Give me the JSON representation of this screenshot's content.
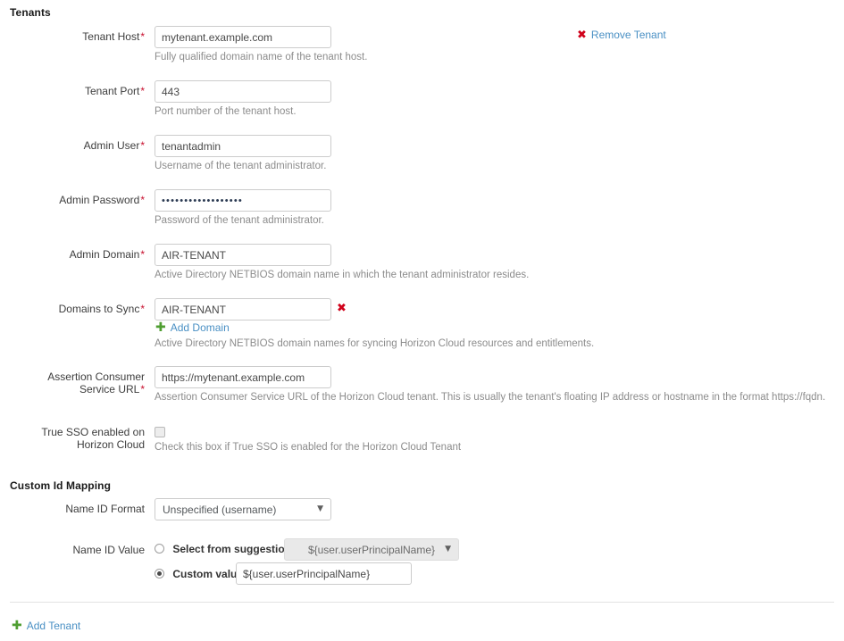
{
  "sections": {
    "tenants_title": "Tenants",
    "custom_id_mapping_title": "Custom Id Mapping"
  },
  "actions": {
    "remove_tenant": "Remove Tenant",
    "remove_tenant_icon": "x-icon",
    "add_domain": "Add Domain",
    "add_domain_icon": "plus-icon",
    "remove_domain_icon": "x-icon",
    "add_tenant": "Add Tenant",
    "add_tenant_icon": "plus-icon"
  },
  "fields": {
    "tenant_host": {
      "label": "Tenant Host",
      "required": "*",
      "value": "mytenant.example.com",
      "help": "Fully qualified domain name of the tenant host."
    },
    "tenant_port": {
      "label": "Tenant Port",
      "required": "*",
      "value": "443",
      "help": "Port number of the tenant host."
    },
    "admin_user": {
      "label": "Admin User",
      "required": "*",
      "value": "tenantadmin",
      "help": "Username of the tenant administrator."
    },
    "admin_password": {
      "label": "Admin Password",
      "required": "*",
      "value": "••••••••••••••••••",
      "help": "Password of the tenant administrator."
    },
    "admin_domain": {
      "label": "Admin Domain",
      "required": "*",
      "value": "AIR-TENANT",
      "help": "Active Directory NETBIOS domain name in which the tenant administrator resides."
    },
    "domains_to_sync": {
      "label": "Domains to Sync",
      "required": "*",
      "value": "AIR-TENANT",
      "help": "Active Directory NETBIOS domain names for syncing Horizon Cloud resources and entitlements."
    },
    "acs_url": {
      "label_line1": "Assertion Consumer",
      "label_line2": "Service URL",
      "required": "*",
      "value": "https://mytenant.example.com",
      "help": "Assertion Consumer Service URL of the Horizon Cloud tenant. This is usually the tenant's floating IP address or hostname in the format https://fqdn."
    },
    "true_sso": {
      "label_line1": "True SSO enabled on",
      "label_line2": "Horizon Cloud",
      "checked": false,
      "help": "Check this box if True SSO is enabled for the Horizon Cloud Tenant"
    },
    "name_id_format": {
      "label": "Name ID Format",
      "selected": "Unspecified (username)"
    },
    "name_id_value": {
      "label": "Name ID Value",
      "suggestion_radio_label": "Select from suggestions",
      "suggestion_selected": "${user.userPrincipalName}",
      "suggestion_checked": false,
      "custom_radio_label": "Custom value",
      "custom_checked": true,
      "custom_value": "${user.userPrincipalName}"
    }
  },
  "colors": {
    "link": "#4a90c4",
    "required": "#c8102e",
    "remove": "#d0021b",
    "add": "#4f9e31",
    "help_text": "#8c8c8c"
  }
}
